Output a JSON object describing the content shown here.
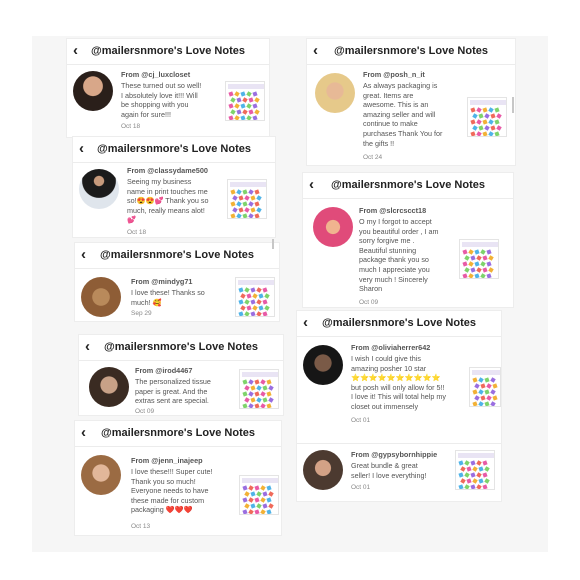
{
  "header_title": "@mailersnmore's Love Notes",
  "colors": {
    "text": "#555555",
    "title": "#222222",
    "date": "#888888",
    "background": "#f6f6f6",
    "card": "#ffffff"
  },
  "icons": {
    "back": "chevron-left-icon",
    "avatar": "avatar",
    "thumbnail": "product-thumbnail"
  },
  "cards": [
    {
      "title": "@mailersnmore's Love Notes",
      "notes": [
        {
          "from": "From @cj_luxcloset",
          "message": "These turned out so well!\nI absolutely love it!!! Will\nbe shopping with you\nagain for sure!!!",
          "date": "Oct 18"
        }
      ]
    },
    {
      "title": "@mailersnmore's Love Notes",
      "notes": [
        {
          "from": "From @classydame500",
          "message": "Seeing my business\nname in print touches me\nso!😍😍💕 Thank you so\nmuch, really means alot!\n💕",
          "date": "Oct 18"
        }
      ]
    },
    {
      "title": "@mailersnmore's Love Notes",
      "notes": [
        {
          "from": "From @mindyg71",
          "message": "I love these! Thanks so\nmuch! 🥰",
          "date": "Sep 29"
        }
      ]
    },
    {
      "title": "@mailersnmore's Love Notes",
      "notes": [
        {
          "from": "From @irod4467",
          "message": "The personalized tissue\npaper is great. And the\nextras sent are special.",
          "date": "Oct 09"
        }
      ]
    },
    {
      "title": "@mailersnmore's Love Notes",
      "notes": [
        {
          "from": "From @jenn_inajeep",
          "message": "I love these!!! Super cute!\nThank you so much!\nEveryone needs to have\nthese made for custom\npackaging ❤️❤️❤️",
          "date": "Oct 13"
        }
      ]
    },
    {
      "title": "@mailersnmore's Love Notes",
      "notes": [
        {
          "from": "From @posh_n_it",
          "message": "As always packaging is\ngreat. Items are\nawesome. This is an\namazing seller and will\ncontinue to make\npurchases Thank You for\nthe gifts !!",
          "date": "Oct 24"
        }
      ]
    },
    {
      "title": "@mailersnmore's Love Notes",
      "notes": [
        {
          "from": "From @slcrcscct18",
          "message": "O my I forgot to accept\nyou beautiful order , I am\nsorry forgive me .\nBeautiful stunning\npackage thank you so\nmuch I appreciate you\nvery much ! Sincerely\nSharon",
          "date": "Oct 09"
        }
      ]
    },
    {
      "title": "@mailersnmore's Love Notes",
      "notes": [
        {
          "from": "From @oliviaherrer642",
          "message": "I wish I could give this\namazing posher 10 star\n⭐⭐⭐⭐⭐⭐⭐⭐⭐⭐\nbut posh will only allow for 5!!\nI love it! This will total help my\ncloset out immensely",
          "date": "Oct 01"
        },
        {
          "from": "From @gypsybornhippie",
          "message": "Great bundle & great\nseller! I love everything!",
          "date": "Oct 01"
        }
      ]
    }
  ]
}
